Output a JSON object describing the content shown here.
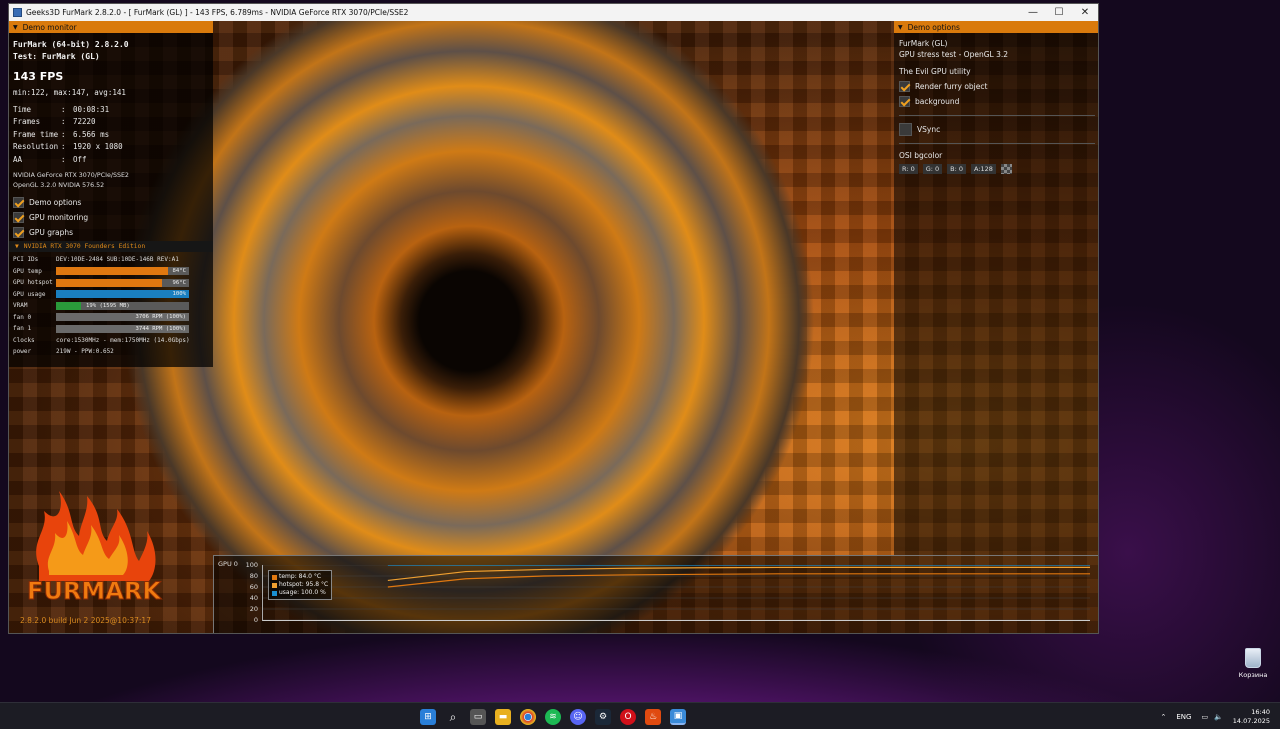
{
  "window": {
    "title": "Geeks3D FurMark 2.8.2.0 - [ FurMark (GL) ] - 143 FPS, 6.789ms - NVIDIA GeForce RTX 3070/PCIe/SSE2",
    "minimize": "—",
    "maximize": "☐",
    "close": "✕"
  },
  "demo_monitor": {
    "header": "Demo monitor",
    "app_line": "FurMark (64-bit) 2.8.2.0",
    "test_line": "Test: FurMark (GL)",
    "fps": "143 FPS",
    "minmax": "min:122, max:147, avg:141",
    "stats": [
      {
        "key": "Time",
        "value": "00:08:31"
      },
      {
        "key": "Frames",
        "value": "72220"
      },
      {
        "key": "Frame time",
        "value": "6.566 ms"
      },
      {
        "key": "Resolution",
        "value": "1920 x 1080"
      },
      {
        "key": "AA",
        "value": "Off"
      }
    ],
    "gpu_name": "NVIDIA GeForce RTX 3070/PCIe/SSE2",
    "opengl": "OpenGL 3.2.0 NVIDIA 576.52",
    "checks": [
      {
        "label": "Demo options",
        "checked": true
      },
      {
        "label": "GPU monitoring",
        "checked": true
      },
      {
        "label": "GPU graphs",
        "checked": true
      }
    ]
  },
  "gpu_monitor": {
    "header": "NVIDIA RTX 3070 Founders Edition",
    "pci_key": "PCI IDs",
    "pci_value": "DEV:10DE-2484 SUB:10DE-146B REV:A1",
    "bars": [
      {
        "key": "GPU temp",
        "text": "84°C",
        "fill": 0.84,
        "color": "#e07810"
      },
      {
        "key": "GPU hotspot",
        "text": "96°C",
        "fill": 0.8,
        "color": "#e07810"
      },
      {
        "key": "GPU usage",
        "text": "100%",
        "fill": 1.0,
        "color": "#1a7fc0"
      },
      {
        "key": "VRAM",
        "text": "19% (1595 MB)",
        "fill": 0.19,
        "color": "#2a9a3a"
      },
      {
        "key": "fan 0",
        "text": "3706 RPM (100%)",
        "fill": 1.0,
        "color": "#6a6a6a"
      },
      {
        "key": "fan 1",
        "text": "3744 RPM (100%)",
        "fill": 1.0,
        "color": "#6a6a6a"
      }
    ],
    "clocks_key": "Clocks",
    "clocks_value": "core:1530MHz - mem:1750MHz (14.0Gbps)",
    "power_key": "power",
    "power_value": "219W - PPW:0.652"
  },
  "logo": {
    "text": "FURMARK"
  },
  "build": "2.8.2.0 build Jun  2 2025@10:37:17",
  "demo_options": {
    "header": "Demo options",
    "title": "FurMark (GL)",
    "subtitle": "GPU stress test - OpenGL 3.2",
    "section": "The Evil GPU utility",
    "checks": [
      {
        "label": "Render furry object",
        "checked": true
      },
      {
        "label": "background",
        "checked": true
      }
    ],
    "vsync": {
      "label": "VSync",
      "checked": false
    },
    "bgcolor_label": "OSI bgcolor",
    "rgba": [
      "R: 0",
      "G: 0",
      "B: 0",
      "A:128"
    ]
  },
  "graph": {
    "title": "GPU 0",
    "y_ticks": [
      "100",
      "80",
      "60",
      "40",
      "20",
      "0"
    ],
    "legend": [
      {
        "label": "temp: 84.0 °C",
        "color": "#e07810"
      },
      {
        "label": "hotspot: 95.8 °C",
        "color": "#f0a030"
      },
      {
        "label": "usage: 100.0 %",
        "color": "#1a8fd0"
      }
    ]
  },
  "chart_data": {
    "type": "line",
    "title": "GPU 0",
    "ylim": [
      0,
      100
    ],
    "series": [
      {
        "name": "temp: 84.0 °C",
        "values": [
          60,
          75,
          80,
          82,
          83,
          84,
          84,
          84,
          84,
          84
        ]
      },
      {
        "name": "hotspot: 95.8 °C",
        "values": [
          72,
          88,
          92,
          94,
          95,
          95.5,
          95.8,
          95.8,
          95.8,
          95.8
        ]
      },
      {
        "name": "usage: 100.0 %",
        "values": [
          100,
          100,
          100,
          100,
          100,
          100,
          100,
          100,
          100,
          100
        ]
      }
    ]
  },
  "desktop": {
    "recycle_bin": "Корзина"
  },
  "taskbar": {
    "icons": [
      "windows-icon",
      "search-icon",
      "task-view-icon",
      "file-explorer-icon",
      "chrome-icon",
      "spotify-icon",
      "discord-icon",
      "steam-icon",
      "opera-icon",
      "furmark-icon",
      "app-icon"
    ],
    "lang": "ENG",
    "time": "16:40",
    "date": "14.07.2025"
  }
}
